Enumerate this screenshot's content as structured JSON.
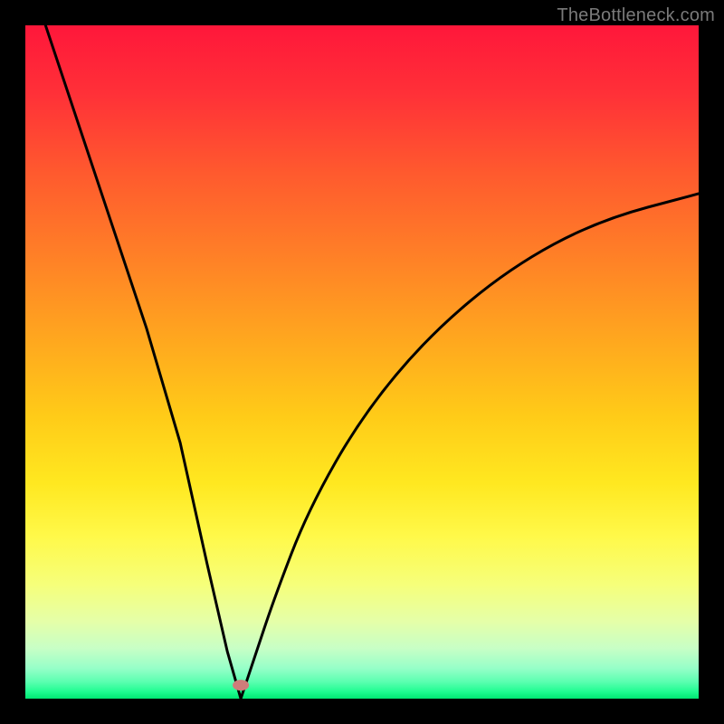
{
  "watermark": "TheBottleneck.com",
  "chart_data": {
    "type": "line",
    "title": "",
    "xlabel": "",
    "ylabel": "",
    "xlim": [
      0,
      100
    ],
    "ylim": [
      0,
      100
    ],
    "curve": {
      "description": "Asymmetric V-shaped bottleneck curve on rainbow gradient; minimum near x≈32 at y≈0, left branch climbs near-vertically to top-left corner, right branch curves upward toward roughly (100,75).",
      "min_x": 32,
      "min_y": 0,
      "left_top": {
        "x": 3,
        "y": 100
      },
      "right_end": {
        "x": 100,
        "y": 75
      },
      "series_points": [
        {
          "x": 3,
          "y": 100
        },
        {
          "x": 8,
          "y": 85
        },
        {
          "x": 13,
          "y": 70
        },
        {
          "x": 18,
          "y": 55
        },
        {
          "x": 23,
          "y": 38
        },
        {
          "x": 27,
          "y": 20
        },
        {
          "x": 30,
          "y": 7
        },
        {
          "x": 32,
          "y": 0
        },
        {
          "x": 34,
          "y": 6
        },
        {
          "x": 37,
          "y": 15
        },
        {
          "x": 42,
          "y": 28
        },
        {
          "x": 50,
          "y": 42
        },
        {
          "x": 60,
          "y": 54
        },
        {
          "x": 72,
          "y": 64
        },
        {
          "x": 85,
          "y": 71
        },
        {
          "x": 100,
          "y": 75
        }
      ]
    },
    "marker": {
      "x": 32,
      "y": 2,
      "color": "#cf7d7a"
    },
    "gradient_stops": [
      {
        "pos": 0.0,
        "color": "#ff173a"
      },
      {
        "pos": 0.1,
        "color": "#ff3038"
      },
      {
        "pos": 0.22,
        "color": "#ff5a2e"
      },
      {
        "pos": 0.34,
        "color": "#ff7f27"
      },
      {
        "pos": 0.46,
        "color": "#ffa51f"
      },
      {
        "pos": 0.58,
        "color": "#ffcb18"
      },
      {
        "pos": 0.68,
        "color": "#ffe820"
      },
      {
        "pos": 0.76,
        "color": "#fff94a"
      },
      {
        "pos": 0.83,
        "color": "#f6ff7a"
      },
      {
        "pos": 0.885,
        "color": "#e5ffa8"
      },
      {
        "pos": 0.925,
        "color": "#c8ffc6"
      },
      {
        "pos": 0.955,
        "color": "#96ffc8"
      },
      {
        "pos": 0.975,
        "color": "#5bffb0"
      },
      {
        "pos": 0.99,
        "color": "#1efc90"
      },
      {
        "pos": 1.0,
        "color": "#00e672"
      }
    ]
  }
}
